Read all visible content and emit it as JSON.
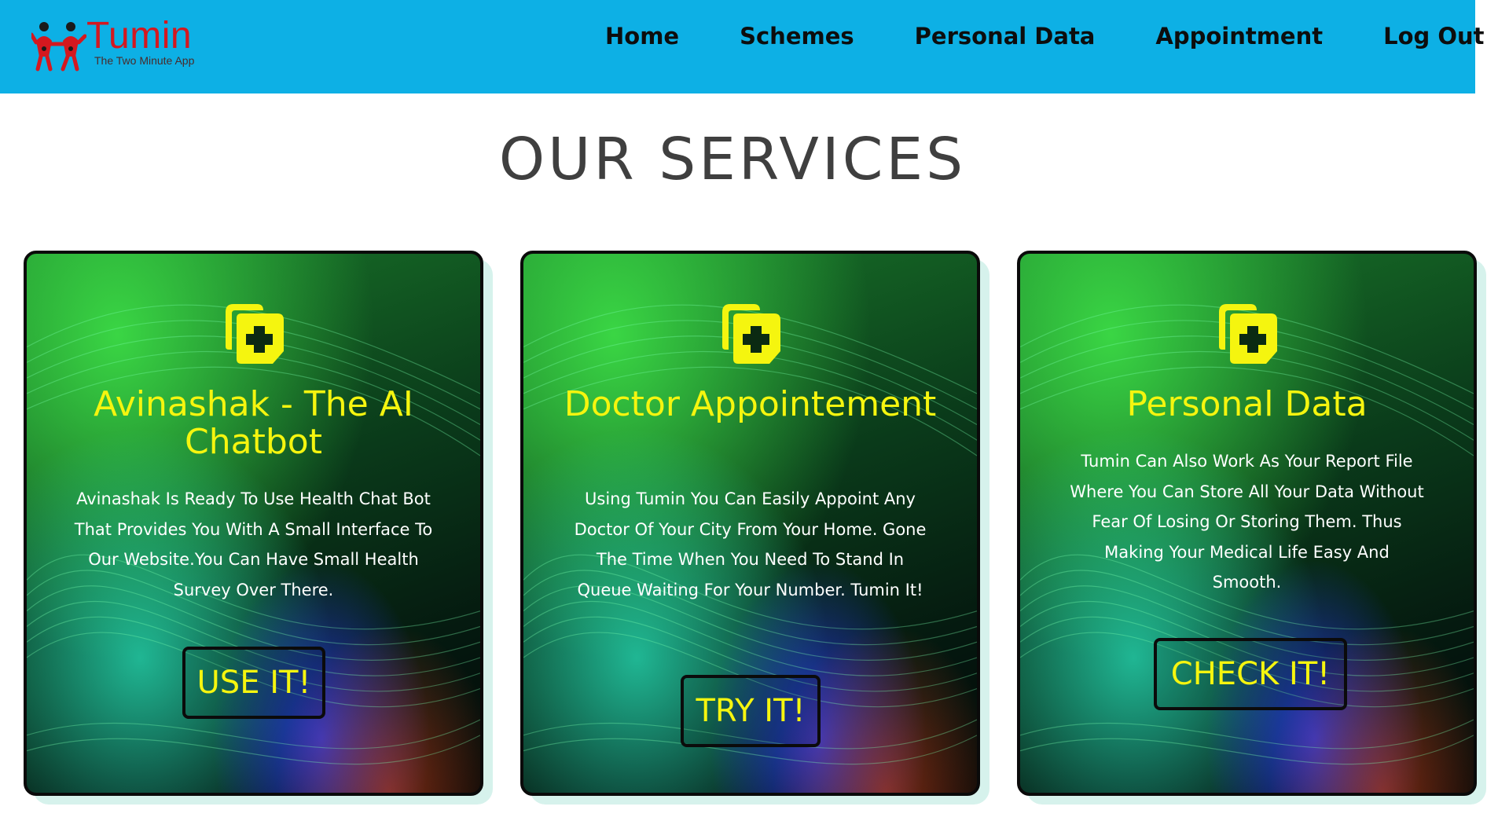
{
  "brand": {
    "name": "Tumin",
    "tagline": "The Two Minute App",
    "logo_icon": "children-icon",
    "color": "#d4181f"
  },
  "nav": {
    "background": "#0db0e5",
    "items": [
      {
        "label": "Home"
      },
      {
        "label": "Schemes"
      },
      {
        "label": "Personal Data"
      },
      {
        "label": "Appointment"
      },
      {
        "label": "Log Out"
      }
    ]
  },
  "main": {
    "heading": "OUR SERVICES"
  },
  "cards": [
    {
      "icon": "medical-folder-icon",
      "title": "Avinashak - The AI Chatbot",
      "description": "Avinashak Is Ready To Use Health Chat Bot That Provides You With A Small Interface To Our Website.You Can Have Small Health Survey Over There.",
      "button": "USE IT!"
    },
    {
      "icon": "medical-folder-icon",
      "title": "Doctor Appointement",
      "description": "Using Tumin You Can Easily Appoint Any Doctor Of Your City From Your Home. Gone The Time When You Need To Stand In Queue Waiting For Your Number. Tumin It!",
      "button": "TRY IT!"
    },
    {
      "icon": "medical-folder-icon",
      "title": "Personal Data",
      "description": "Tumin Can Also Work As Your Report File Where You Can Store All Your Data Without Fear Of Losing Or Storing Them. Thus Making Your Medical Life Easy And Smooth.",
      "button": "CHECK IT!"
    }
  ],
  "colors": {
    "accent_text": "#f5f50f",
    "heading": "#3f3f3f",
    "card_shadow": "#d6f2ec"
  }
}
